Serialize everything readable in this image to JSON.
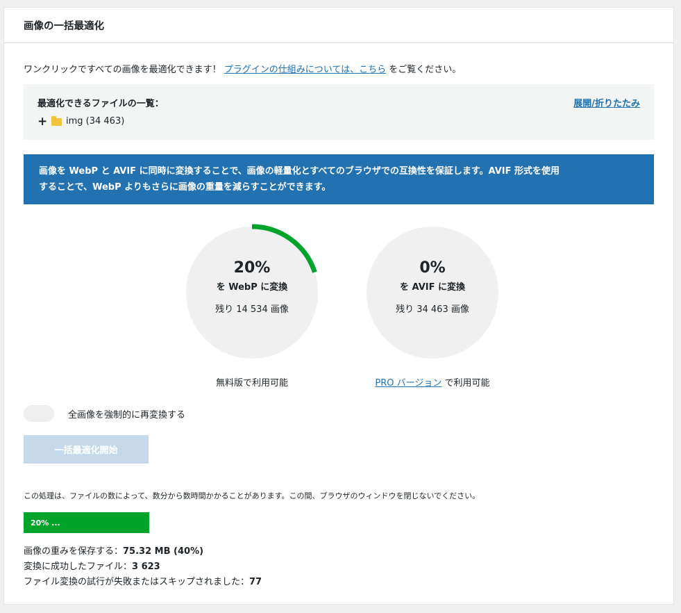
{
  "panel": {
    "title": "画像の一括最適化",
    "intro_text": "ワンクリックですべての画像を最適化できます！",
    "intro_link": "プラグインの仕組みについては、こちら",
    "intro_suffix": "をご覧ください。"
  },
  "files": {
    "title": "最適化できるファイルの一覧：",
    "toggle_label": "展開/折りたたみ",
    "tree": [
      {
        "expander": "+",
        "name": "img (34 463)"
      }
    ]
  },
  "banner": {
    "line1": "画像を WebP と AVIF に同時に変換することで、画像の軽量化とすべてのブラウザでの互換性を保証します。AVIF 形式を使用",
    "line2": "することで、WebP よりもさらに画像の重量を減らすことができます。"
  },
  "gauges": {
    "webp": {
      "percent": 20,
      "percent_label": "20%",
      "label": "を WebP に変換",
      "remaining": "残り 14 534 画像",
      "availability": "無料版で利用可能"
    },
    "avif": {
      "percent": 0,
      "percent_label": "0%",
      "label": "を AVIF に変換",
      "remaining": "残り 34 463 画像",
      "availability_link": "PRO バージョン",
      "availability_suffix": "で利用可能"
    }
  },
  "colors": {
    "accent": "#2271b1",
    "success": "#00a32a",
    "gauge_bg": "#f0f0f0"
  },
  "force": {
    "label": "全画像を強制的に再変換する",
    "enabled": false
  },
  "start_button": {
    "label": "一括最適化開始",
    "disabled": true
  },
  "notice": "この処理は、ファイルの数によって、数分から数時間かかることがあります。この間、ブラウザのウィンドウを閉じないでください。",
  "progress": {
    "label": "20% ...",
    "percent": 20
  },
  "stats": {
    "saved_label": "画像の重みを保存する：",
    "saved_value": "75.32 MB (40%)",
    "success_label": "変換に成功したファイル：",
    "success_value": "3 623",
    "failed_label": "ファイル変換の試行が失敗またはスキップされました：",
    "failed_value": "77"
  }
}
